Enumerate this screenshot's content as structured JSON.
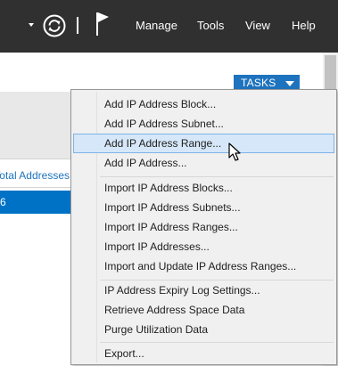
{
  "header": {
    "menu": [
      "Manage",
      "Tools",
      "View",
      "Help"
    ],
    "icons": [
      "dropdown-arrow-icon",
      "refresh-icon",
      "flag-icon"
    ]
  },
  "tasks": {
    "label": "TASKS"
  },
  "left_panel": {
    "column_header": "Total Addresses",
    "selected_value": "6"
  },
  "context_menu": {
    "groups": [
      [
        "Add IP Address Block...",
        "Add IP Address Subnet...",
        "Add IP Address Range...",
        "Add IP Address..."
      ],
      [
        "Import IP Address Blocks...",
        "Import IP Address Subnets...",
        "Import IP Address Ranges...",
        "Import IP Addresses...",
        "Import and Update IP Address Ranges..."
      ],
      [
        "IP Address Expiry Log Settings...",
        "Retrieve Address Space Data",
        "Purge Utilization Data"
      ],
      [
        "Export..."
      ]
    ],
    "highlighted": "Add IP Address Range..."
  }
}
